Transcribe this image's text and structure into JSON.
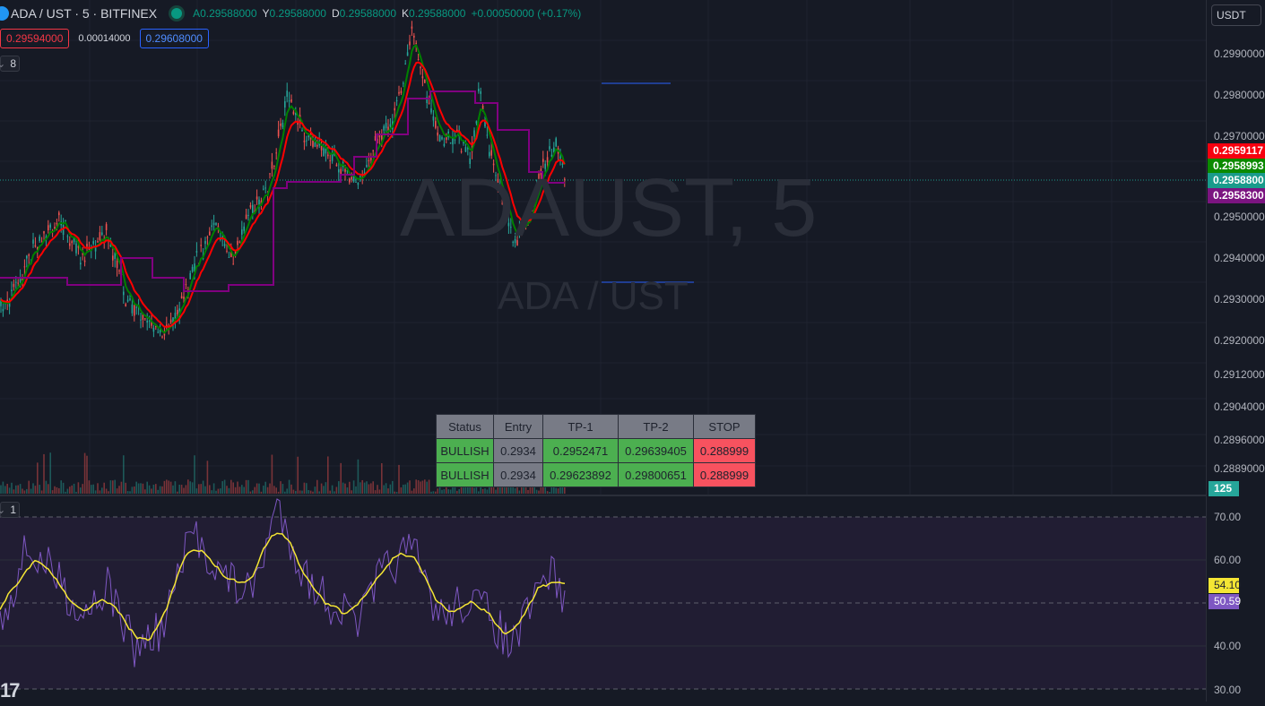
{
  "header": {
    "title": "ADA / UST · 5 · BITFINEX",
    "ohlc": [
      {
        "key": "A",
        "value": "0.29588000"
      },
      {
        "key": "Y",
        "value": "0.29588000"
      },
      {
        "key": "D",
        "value": "0.29588000"
      },
      {
        "key": "K",
        "value": "0.29588000"
      }
    ],
    "change": "+0.00050000 (+0.17%)",
    "sell_price": "0.29594000",
    "spread": "0.00014000",
    "buy_price": "0.29608000",
    "indicator_count_main": "8",
    "indicator_count_rsi": "1"
  },
  "watermark": {
    "symbol": "ADAUST, 5",
    "pair": "ADA / UST"
  },
  "price_axis": {
    "currency": "USDT",
    "labels": [
      "0.2990000",
      "0.2980000",
      "0.2970000",
      "0.2950000",
      "0.2940000",
      "0.2930000",
      "0.2920000",
      "0.2912000",
      "0.2904000",
      "0.2896000",
      "0.2889000"
    ],
    "tags": [
      {
        "text": "0.2959117",
        "color": "#f7000f"
      },
      {
        "text": "0.2958993",
        "color": "#0b8a00"
      },
      {
        "text": "0.2958800",
        "color": "#199b8b"
      },
      {
        "text": "0.2958300",
        "color": "#7b1480"
      }
    ],
    "volume_tag": {
      "text": "125",
      "color": "#26a69a"
    }
  },
  "rsi_axis": {
    "labels": [
      "70.00",
      "60.00",
      "40.00",
      "30.00"
    ],
    "tags": [
      {
        "text": "54.10",
        "color": "#f5e634"
      },
      {
        "text": "50.59",
        "color": "#7e57c2"
      }
    ]
  },
  "signal_table": {
    "headers": [
      "Status",
      "Entry",
      "TP-1",
      "TP-2",
      "STOP"
    ],
    "rows": [
      [
        "BULLISH",
        "0.2934",
        "0.2952471",
        "0.29639405",
        "0.288999"
      ],
      [
        "BULLISH",
        "0.2934",
        "0.29623892",
        "0.29800651",
        "0.288999"
      ]
    ]
  },
  "colors": {
    "bull": "#26a69a",
    "bear": "#ef5350",
    "ema_fast": "#008000",
    "ema_slow": "#ff0000",
    "channel": "#800080",
    "rsi": "#7e57c2",
    "rsi_ma": "#f5e634",
    "level_line": "#2962ff"
  }
}
